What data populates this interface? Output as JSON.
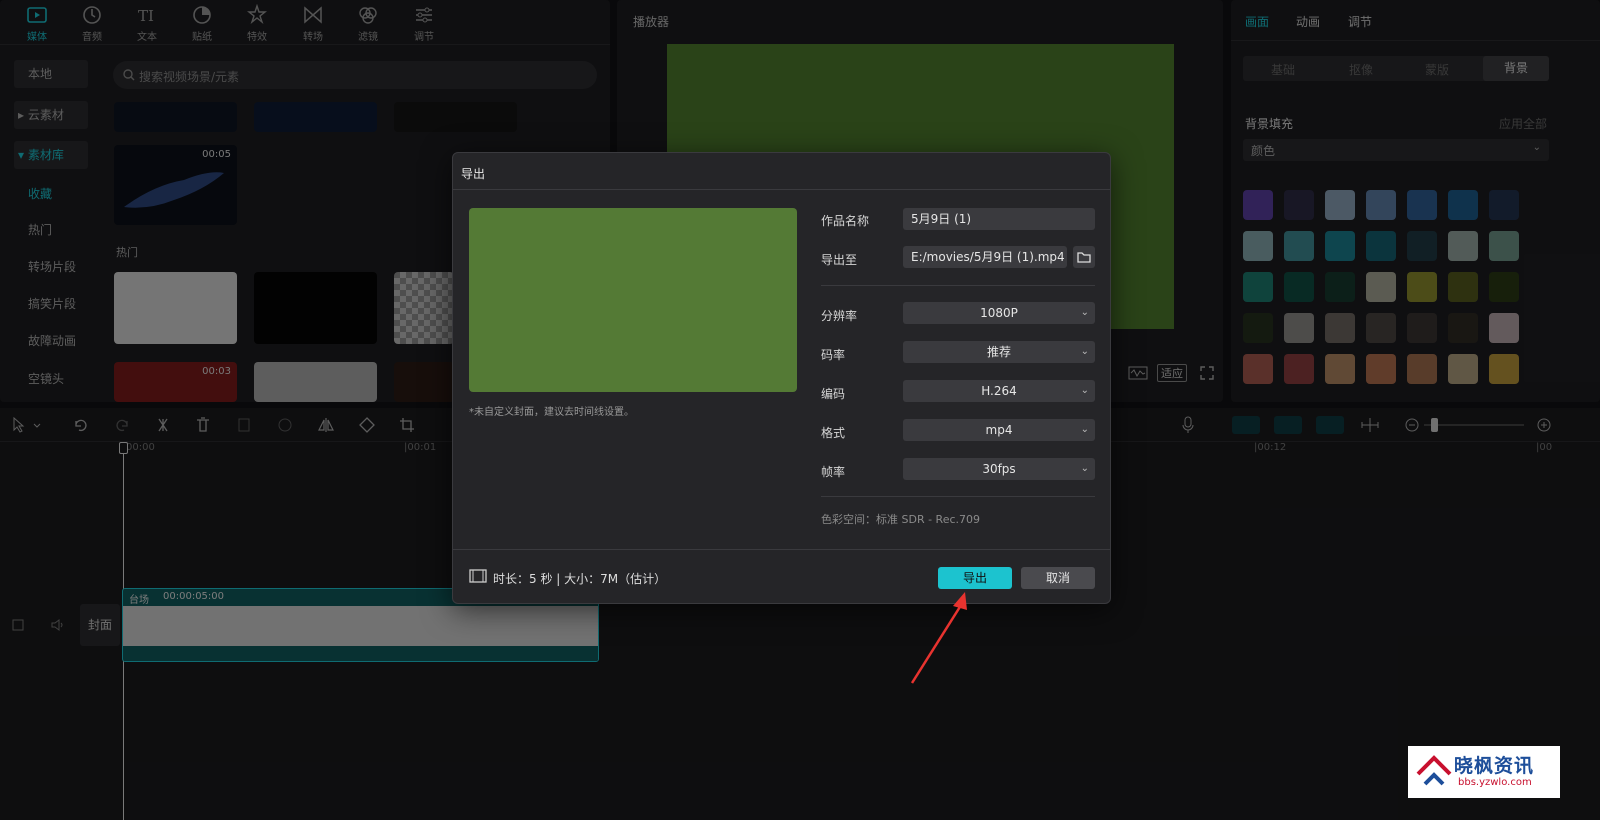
{
  "toolbar": {
    "tabs": [
      {
        "label": "媒体",
        "icon": "media-icon"
      },
      {
        "label": "音频",
        "icon": "audio-icon"
      },
      {
        "label": "文本",
        "icon": "text-icon"
      },
      {
        "label": "贴纸",
        "icon": "sticker-icon"
      },
      {
        "label": "特效",
        "icon": "effects-icon"
      },
      {
        "label": "转场",
        "icon": "transition-icon"
      },
      {
        "label": "滤镜",
        "icon": "filter-icon"
      },
      {
        "label": "调节",
        "icon": "adjust-icon"
      }
    ]
  },
  "media": {
    "sidebar": [
      "本地",
      "▸ 云素材",
      "▾ 素材库",
      "收藏",
      "热门",
      "转场片段",
      "搞笑片段",
      "故障动画",
      "空镜头"
    ],
    "search_placeholder": "搜索视频场景/元素",
    "section_hot": "热门",
    "thumb_durations": [
      "00:05",
      "00:03"
    ]
  },
  "player": {
    "title": "播放器",
    "ratio_label": "适应"
  },
  "props": {
    "tabs": [
      "画面",
      "动画",
      "调节"
    ],
    "subtabs": [
      "基础",
      "抠像",
      "蒙版",
      "背景"
    ],
    "bg_fill_label": "背景填充",
    "apply_all": "应用全部",
    "fill_type": "颜色",
    "swatch_colors": [
      "#5a3fa0",
      "#2c2a44",
      "#8aa2b8",
      "#5d7fa6",
      "#2f5d93",
      "#1d5b8a",
      "#22324e",
      "#86a8ad",
      "#3f8b94",
      "#1b7f8e",
      "#145f70",
      "#1f3a44",
      "#96a6a0",
      "#6e9488",
      "#1d7b6e",
      "#0f4e43",
      "#173a2e",
      "#a6a696",
      "#8a8a2c",
      "#555a1e",
      "#2a3a14",
      "#26301e",
      "#8c8a88",
      "#6e6662",
      "#4a4440",
      "#3a3432",
      "#2e2a24",
      "#b4a4a8",
      "#a4584e",
      "#8a3c3e",
      "#b08662",
      "#b06e4e",
      "#a06e4e",
      "#b09e7e",
      "#b6943a"
    ]
  },
  "timeline": {
    "ticks": [
      "00:00",
      "|00:01",
      "|00:12",
      "|00"
    ],
    "clip_label": "台场",
    "clip_time": "00:00:05:00",
    "cover_label": "封面"
  },
  "export": {
    "title": "导出",
    "cover_hint": "*未自定义封面，建议去时间线设置。",
    "name_label": "作品名称",
    "name_value": "5月9日 (1)",
    "path_label": "导出至",
    "path_value": "E:/movies/5月9日 (1).mp4",
    "resolution_label": "分辨率",
    "resolution_value": "1080P",
    "bitrate_label": "码率",
    "bitrate_value": "推荐",
    "codec_label": "编码",
    "codec_value": "H.264",
    "format_label": "格式",
    "format_value": "mp4",
    "fps_label": "帧率",
    "fps_value": "30fps",
    "color_space": "色彩空间：标准 SDR - Rec.709",
    "footer_info": "时长：5 秒 | 大小：7M（估计）",
    "export_button": "导出",
    "cancel_button": "取消",
    "preview_color": "#547a35",
    "accent_color": "#1cc3cf"
  },
  "watermark": {
    "name": "晓枫资讯",
    "url": "bbs.yzwlo.com"
  }
}
